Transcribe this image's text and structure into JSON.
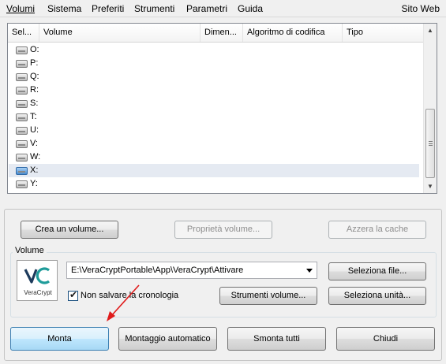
{
  "menu": {
    "items": [
      {
        "u": "V",
        "rest": "olumi"
      },
      {
        "u": "S",
        "rest": "istema"
      },
      {
        "u": "",
        "rest": "Preferiti",
        "u2": "f",
        "pre": "Pre",
        "post": "eriti"
      },
      {
        "u": "S",
        "rest": "trumenti"
      },
      {
        "u": "P",
        "rest": "arametri"
      },
      {
        "u": "G",
        "rest": "uida"
      }
    ],
    "labels": [
      "Volumi",
      "Sistema",
      "Preferiti",
      "Strumenti",
      "Parametri",
      "Guida"
    ],
    "site": "Sito Web"
  },
  "table": {
    "columns": [
      "Sel...",
      "Volume",
      "Dimen...",
      "Algoritmo di codifica",
      "Tipo"
    ],
    "rows": [
      "O:",
      "P:",
      "Q:",
      "R:",
      "S:",
      "T:",
      "U:",
      "V:",
      "W:",
      "X:",
      "Y:"
    ],
    "selected_row": "X:"
  },
  "buttons": {
    "create_volume": "Crea un volume...",
    "volume_properties": "Proprietà volume...",
    "clear_cache": "Azzera la cache",
    "select_file": "Seleziona file...",
    "volume_tools": "Strumenti volume...",
    "select_device": "Seleziona unità...",
    "mount": "Monta",
    "auto_mount": "Montaggio automatico",
    "dismount_all": "Smonta tutti",
    "close": "Chiudi"
  },
  "volume": {
    "group_title": "Volume",
    "path": "E:\\VeraCryptPortable\\App\\VeraCrypt\\Attivare",
    "no_history_label": "Non salvare la cronologia",
    "no_history_checked": true,
    "logo_text": "VeraCrypt"
  },
  "colors": {
    "logo_teal": "#1f9c9a",
    "logo_dark": "#1d3b5c",
    "arrow": "#e01b1b",
    "selection": "#e5eaf2"
  }
}
